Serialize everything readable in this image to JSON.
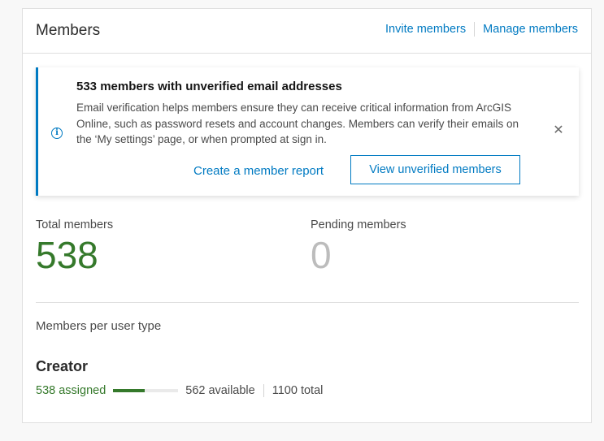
{
  "card": {
    "title": "Members",
    "invite_label": "Invite members",
    "manage_label": "Manage members"
  },
  "notice": {
    "icon": "info-icon",
    "title": "533 members with unverified email addresses",
    "text": "Email verification helps members ensure they can receive critical information from ArcGIS Online, such as password resets and account changes. Members can verify their emails on the ‘My settings’ page, or when prompted at sign in.",
    "close_icon": "close-icon",
    "report_link": "Create a member report",
    "view_button": "View unverified members"
  },
  "stats": {
    "total_label": "Total members",
    "total_value": "538",
    "pending_label": "Pending members",
    "pending_value": "0"
  },
  "user_types": {
    "heading": "Members per user type",
    "items": [
      {
        "name": "Creator",
        "assigned": "538 assigned",
        "available": "562 available",
        "total": "1100 total",
        "assigned_fraction": 0.49
      }
    ]
  },
  "colors": {
    "accent": "#007ac2",
    "success": "#35792b",
    "muted": "#bcbcbc"
  }
}
